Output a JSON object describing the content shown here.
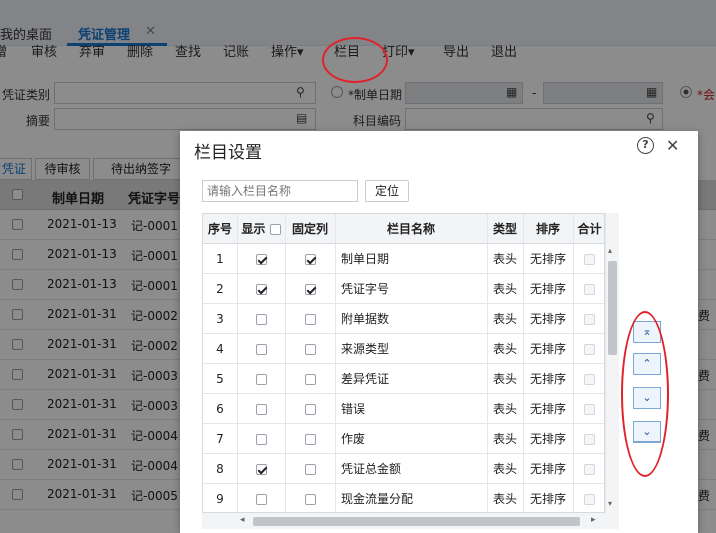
{
  "tabs": {
    "desk": "我的桌面",
    "voucher": "凭证管理",
    "close": "✕"
  },
  "toolbar": [
    "增",
    "审核",
    "弃审",
    "删除",
    "查找",
    "记账",
    "操作",
    "栏目",
    "打印",
    "导出",
    "退出"
  ],
  "toolbar_dropdown": "▾",
  "filter": {
    "type_label": "凭证类别",
    "summary_label": "摘要",
    "date_label": "*制单日期",
    "range_sep": "-",
    "code_label": "科目编码",
    "radio_label": "*会"
  },
  "subtabs": {
    "voucher": "凭证",
    "pending_review": "待审核",
    "pending_cashier": "待出纳签字"
  },
  "grid": {
    "headers": {
      "date": "制单日期",
      "voucher_no": "凭证字号"
    },
    "rows": [
      {
        "date": "2021-01-13",
        "no": "记-0001",
        "extra": ""
      },
      {
        "date": "2021-01-13",
        "no": "记-0001",
        "extra": ""
      },
      {
        "date": "2021-01-13",
        "no": "记-0001",
        "extra": ""
      },
      {
        "date": "2021-01-31",
        "no": "记-0002",
        "extra": "费"
      },
      {
        "date": "2021-01-31",
        "no": "记-0002",
        "extra": ""
      },
      {
        "date": "2021-01-31",
        "no": "记-0003",
        "extra": "费"
      },
      {
        "date": "2021-01-31",
        "no": "记-0003",
        "extra": ""
      },
      {
        "date": "2021-01-31",
        "no": "记-0004",
        "extra": "费"
      },
      {
        "date": "2021-01-31",
        "no": "记-0004",
        "extra": ""
      },
      {
        "date": "2021-01-31",
        "no": "记-0005",
        "extra": "费"
      }
    ]
  },
  "modal": {
    "title": "栏目设置",
    "help": "?",
    "close": "✕",
    "search_placeholder": "请输入栏目名称",
    "locate": "定位",
    "headers": {
      "seq": "序号",
      "show": "显示",
      "fixed": "固定列",
      "name": "栏目名称",
      "type": "类型",
      "sort": "排序",
      "sum": "合计"
    },
    "rows": [
      {
        "seq": "1",
        "show": true,
        "fixed": true,
        "name": "制单日期",
        "type": "表头",
        "sort": "无排序"
      },
      {
        "seq": "2",
        "show": true,
        "fixed": true,
        "name": "凭证字号",
        "type": "表头",
        "sort": "无排序"
      },
      {
        "seq": "3",
        "show": false,
        "fixed": false,
        "name": "附单据数",
        "type": "表头",
        "sort": "无排序"
      },
      {
        "seq": "4",
        "show": false,
        "fixed": false,
        "name": "来源类型",
        "type": "表头",
        "sort": "无排序"
      },
      {
        "seq": "5",
        "show": false,
        "fixed": false,
        "name": "差异凭证",
        "type": "表头",
        "sort": "无排序"
      },
      {
        "seq": "6",
        "show": false,
        "fixed": false,
        "name": "错误",
        "type": "表头",
        "sort": "无排序"
      },
      {
        "seq": "7",
        "show": false,
        "fixed": false,
        "name": "作废",
        "type": "表头",
        "sort": "无排序"
      },
      {
        "seq": "8",
        "show": true,
        "fixed": false,
        "name": "凭证总金额",
        "type": "表头",
        "sort": "无排序"
      },
      {
        "seq": "9",
        "show": false,
        "fixed": false,
        "name": "现金流量分配",
        "type": "表头",
        "sort": "无排序"
      }
    ],
    "move_buttons": [
      "⌅",
      "⌃",
      "⌄",
      "⌄"
    ]
  },
  "icons": {
    "search": "⚲",
    "calendar": "▦",
    "clip": "▤",
    "arrow_up": "▴",
    "arrow_down": "▾",
    "arrow_left": "◂",
    "arrow_right": "▸"
  },
  "colors": {
    "accent": "#1677d2",
    "annotation": "#e0232b"
  }
}
